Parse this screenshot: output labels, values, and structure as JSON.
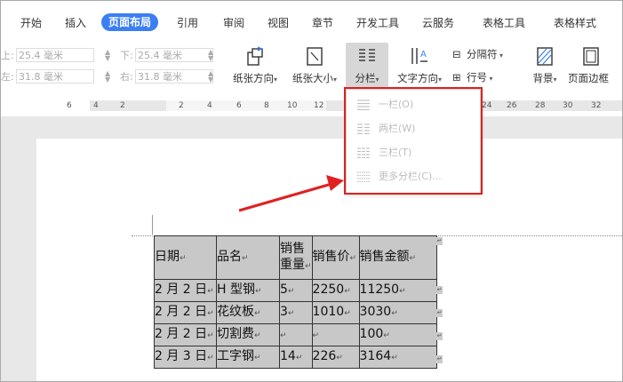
{
  "tabs": [
    "开始",
    "插入",
    "页面布局",
    "引用",
    "审阅",
    "视图",
    "章节",
    "开发工具",
    "云服务",
    "表格工具",
    "表格样式"
  ],
  "active_tab": "页面布局",
  "margins": {
    "top_label": "上:",
    "top_value": "25.4 毫米",
    "bottom_label": "下:",
    "bottom_value": "25.4 毫米",
    "left_label": "左:",
    "left_value": "31.8 毫米",
    "right_label": "右:",
    "right_value": "31.8 毫米"
  },
  "ribbon": {
    "orientation": "纸张方向",
    "size": "纸张大小",
    "columns": "分栏",
    "text_direction": "文字方向",
    "separator": "分隔符",
    "line_number": "行号",
    "background": "背景",
    "page_border": "页面边框"
  },
  "ruler_numbers": [
    "6",
    "4",
    "2",
    "2",
    "4",
    "6",
    "8",
    "10",
    "12",
    "24",
    "26",
    "28",
    "30",
    "32"
  ],
  "columns_menu": {
    "items": [
      "一栏(O)",
      "两栏(W)",
      "三栏(T)",
      "更多分栏(C)..."
    ],
    "highlight_color": "#e02020"
  },
  "table": {
    "headers": [
      "日期",
      "品名",
      "销售重量",
      "销售价",
      "销售金额"
    ],
    "header_lines": [
      [
        "日期"
      ],
      [
        "品名"
      ],
      [
        "销售",
        "重量"
      ],
      [
        "销售价"
      ],
      [
        "销售金额"
      ]
    ],
    "rows": [
      [
        "2 月 2 日",
        "H 型钢",
        "5",
        "2250",
        "11250"
      ],
      [
        "2 月 2 日",
        "花纹板",
        "3",
        "1010",
        "3030"
      ],
      [
        "2 月 2 日",
        "切割费",
        "",
        "",
        "100"
      ],
      [
        "2 月 3 日",
        "工字钢",
        "14",
        "226",
        "3164"
      ]
    ]
  }
}
